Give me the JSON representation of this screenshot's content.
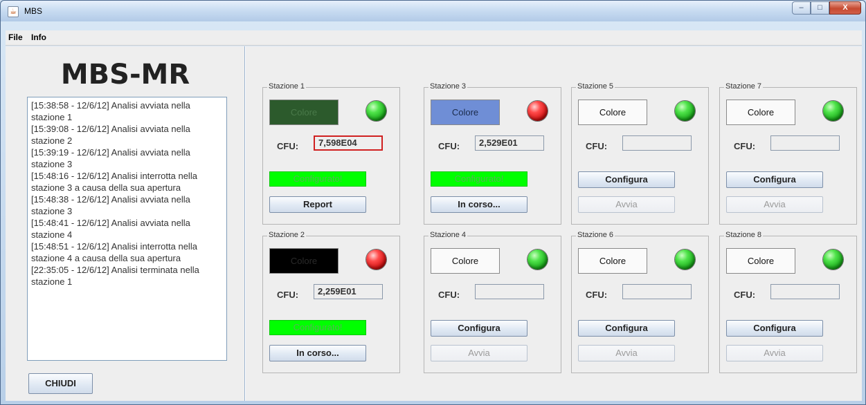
{
  "window": {
    "title": "MBS",
    "controls": {
      "minimize": "–",
      "maximize": "□",
      "close": "X"
    }
  },
  "menu": [
    "File",
    "Info"
  ],
  "left": {
    "title": "MBS-MR",
    "log": [
      "[15:38:58 - 12/6/12] Analisi avviata nella stazione 1",
      "[15:39:08 - 12/6/12] Analisi avviata nella stazione 2",
      "[15:39:19 - 12/6/12] Analisi avviata nella stazione 3",
      "[15:48:16 - 12/6/12] Analisi interrotta nella stazione 3 a causa della sua apertura",
      "[15:48:38 - 12/6/12] Analisi avviata nella stazione 3",
      "[15:48:41 - 12/6/12] Analisi avviata nella stazione 4",
      "[15:48:51 - 12/6/12] Analisi interrotta nella stazione 4 a causa della sua apertura",
      "[22:35:05 - 12/6/12] Analisi terminata nella stazione 1"
    ],
    "close_button": "CHIUDI"
  },
  "labels": {
    "cfu": "CFU:"
  },
  "stations": [
    {
      "name": "Stazione 1",
      "color_label": "Colore",
      "color_bg": "#2c5a2c",
      "color_text": "#4a7a4a",
      "led": "green",
      "cfu": "7,598E04",
      "cfu_alert": true,
      "status": "Configurato!",
      "action": "Report",
      "configured": true
    },
    {
      "name": "Stazione 2",
      "color_label": "Colore",
      "color_bg": "#000000",
      "color_text": "#2a2a2a",
      "led": "red",
      "cfu": "2,259E01",
      "cfu_alert": false,
      "status": "Configurato!",
      "action": "In corso...",
      "configured": true
    },
    {
      "name": "Stazione 3",
      "color_label": "Colore",
      "color_bg": "#6f8ed6",
      "color_text": "#1a2a4a",
      "led": "red",
      "cfu": "2,529E01",
      "cfu_alert": false,
      "status": "Configurato!",
      "action": "In corso...",
      "configured": true
    },
    {
      "name": "Stazione 4",
      "color_label": "Colore",
      "color_bg": "#fafafa",
      "color_text": "#111111",
      "led": "green",
      "cfu": "",
      "cfu_alert": false,
      "status": "Configura",
      "action": "Avvia",
      "configured": false
    },
    {
      "name": "Stazione 5",
      "color_label": "Colore",
      "color_bg": "#fafafa",
      "color_text": "#111111",
      "led": "green",
      "cfu": "",
      "cfu_alert": false,
      "status": "Configura",
      "action": "Avvia",
      "configured": false
    },
    {
      "name": "Stazione 6",
      "color_label": "Colore",
      "color_bg": "#fafafa",
      "color_text": "#111111",
      "led": "green",
      "cfu": "",
      "cfu_alert": false,
      "status": "Configura",
      "action": "Avvia",
      "configured": false
    },
    {
      "name": "Stazione 7",
      "color_label": "Colore",
      "color_bg": "#fafafa",
      "color_text": "#111111",
      "led": "green",
      "cfu": "",
      "cfu_alert": false,
      "status": "Configura",
      "action": "Avvia",
      "configured": false
    },
    {
      "name": "Stazione 8",
      "color_label": "Colore",
      "color_bg": "#fafafa",
      "color_text": "#111111",
      "led": "green",
      "cfu": "",
      "cfu_alert": false,
      "status": "Configura",
      "action": "Avvia",
      "configured": false
    }
  ]
}
